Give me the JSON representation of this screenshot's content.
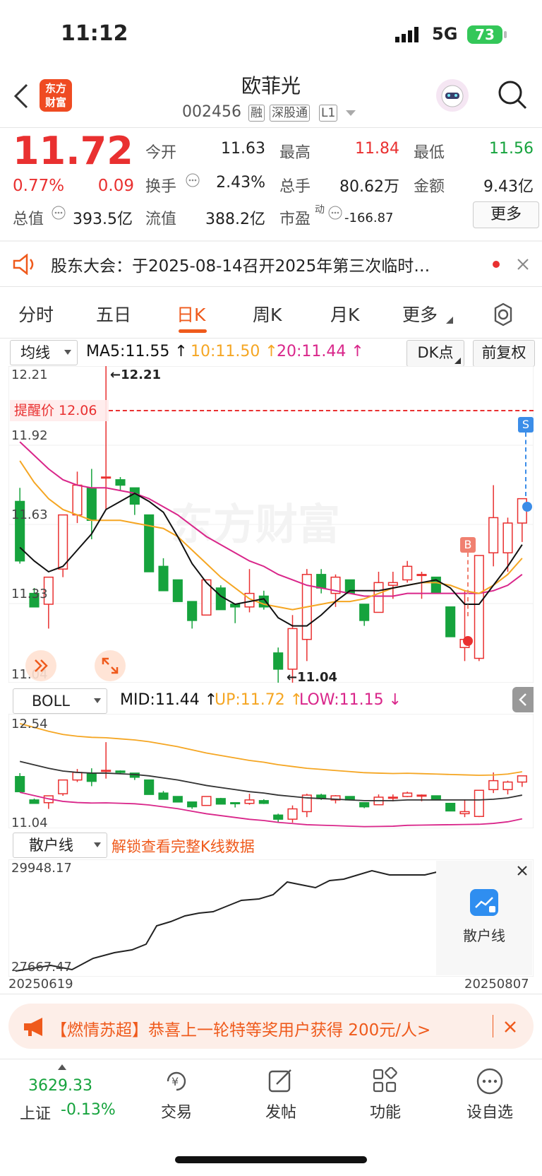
{
  "status": {
    "time": "11:12",
    "network": "5G",
    "battery": "73"
  },
  "nav": {
    "back_icon": "chevron-left-icon",
    "logo_line1": "东方",
    "logo_line2": "财富",
    "stock_name": "欧菲光",
    "stock_code": "002456",
    "tags": [
      "融",
      "深股通",
      "L1"
    ]
  },
  "quote": {
    "price": "11.72",
    "change_pct": "0.77%",
    "change": "0.09",
    "open_label": "今开",
    "open": "11.63",
    "high_label": "最高",
    "high": "11.84",
    "low_label": "最低",
    "low": "11.56",
    "turnover_label": "换手",
    "turnover": "2.43%",
    "volume_label": "总手",
    "volume": "80.62万",
    "amount_label": "金额",
    "amount": "9.43亿",
    "mktcap_label": "总值",
    "mktcap": "393.5亿",
    "float_label": "流值",
    "float_cap": "388.2亿",
    "pe_label": "市盈",
    "pe_sup": "动",
    "pe": "-166.87",
    "more": "更多"
  },
  "notice": {
    "text": "股东大会：于2025-08-14召开2025年第三次临时…"
  },
  "tabs": [
    "分时",
    "五日",
    "日K",
    "周K",
    "月K",
    "更多"
  ],
  "active_tab": 2,
  "kline": {
    "ma_select": "均线",
    "ma5": "MA5:11.55 ↑",
    "ma10": "10:11.50 ↑",
    "ma20": "20:11.44 ↑",
    "dk": "DK点",
    "adjust": "前复权",
    "ytop": "12.21",
    "y2": "11.92",
    "y3": "11.63",
    "y4": "11.33",
    "ybot": "11.04",
    "max_label": "←12.21",
    "min_label": "←11.04",
    "alert": "提醒价 12.06",
    "watermark": "东方财富",
    "sell_marker": "S",
    "buy_marker": "B"
  },
  "boll": {
    "select": "BOLL",
    "mid": "MID:11.44 ↑",
    "up": "UP:11.72 ↑",
    "low": "LOW:11.15 ↓",
    "ytop": "12.54",
    "ybot": "11.04"
  },
  "retail": {
    "select": "散户线",
    "unlock": "解锁查看完整K线数据",
    "ytop": "29948.17",
    "ybot": "27667.47",
    "date_start": "20250619",
    "date_end": "20250807",
    "badge": "散户线"
  },
  "banner": {
    "text": "【燃情苏超】恭喜上一轮特等奖用户获得 200元/人>"
  },
  "tabbar": {
    "index_value": "3629.33",
    "index_name": "上证",
    "index_change": "-0.13%",
    "items": [
      "交易",
      "发帖",
      "功能",
      "设自选"
    ]
  },
  "colors": {
    "up": "#e93030",
    "down": "#16a33d",
    "accent": "#ef5a1c",
    "ma5": "#111111",
    "ma10": "#f5a623",
    "ma20": "#d9268a"
  },
  "chart_data": {
    "type": "candlestick",
    "ylim": [
      11.04,
      12.21
    ],
    "ohlc": [
      [
        11.71,
        11.76,
        11.48,
        11.49
      ],
      [
        11.37,
        11.39,
        11.32,
        11.32
      ],
      [
        11.33,
        11.43,
        11.24,
        11.43
      ],
      [
        11.46,
        11.66,
        11.43,
        11.66
      ],
      [
        11.66,
        11.82,
        11.63,
        11.77
      ],
      [
        11.76,
        11.83,
        11.57,
        11.64
      ],
      [
        11.8,
        12.21,
        11.68,
        11.8
      ],
      [
        11.79,
        11.8,
        11.75,
        11.77
      ],
      [
        11.76,
        11.76,
        11.66,
        11.7
      ],
      [
        11.66,
        11.66,
        11.45,
        11.45
      ],
      [
        11.47,
        11.5,
        11.38,
        11.38
      ],
      [
        11.42,
        11.42,
        11.34,
        11.34
      ],
      [
        11.34,
        11.34,
        11.24,
        11.27
      ],
      [
        11.29,
        11.42,
        11.29,
        11.42
      ],
      [
        11.39,
        11.4,
        11.31,
        11.31
      ],
      [
        11.33,
        11.33,
        11.26,
        11.32
      ],
      [
        11.32,
        11.46,
        11.3,
        11.37
      ],
      [
        11.36,
        11.38,
        11.31,
        11.32
      ],
      [
        11.15,
        11.17,
        11.04,
        11.09
      ],
      [
        11.09,
        11.29,
        11.04,
        11.24
      ],
      [
        11.2,
        11.46,
        11.12,
        11.44
      ],
      [
        11.44,
        11.46,
        11.37,
        11.39
      ],
      [
        11.37,
        11.44,
        11.32,
        11.43
      ],
      [
        11.42,
        11.42,
        11.37,
        11.37
      ],
      [
        11.33,
        11.33,
        11.25,
        11.27
      ],
      [
        11.3,
        11.45,
        11.3,
        11.41
      ],
      [
        11.4,
        11.45,
        11.35,
        11.41
      ],
      [
        11.42,
        11.49,
        11.41,
        11.47
      ],
      [
        11.44,
        11.45,
        11.35,
        11.44
      ],
      [
        11.43,
        11.43,
        11.37,
        11.37
      ],
      [
        11.32,
        11.32,
        11.21,
        11.21
      ],
      [
        11.17,
        11.38,
        11.12,
        11.2
      ],
      [
        11.13,
        11.49,
        11.12,
        11.51
      ],
      [
        11.52,
        11.77,
        11.47,
        11.65
      ],
      [
        11.52,
        11.65,
        11.45,
        11.63
      ],
      [
        11.63,
        11.72,
        11.56,
        11.72
      ]
    ],
    "ma5": [
      11.54,
      11.49,
      11.45,
      11.47,
      11.53,
      11.59,
      11.68,
      11.71,
      11.74,
      11.71,
      11.67,
      11.58,
      11.48,
      11.41,
      11.36,
      11.33,
      11.34,
      11.35,
      11.28,
      11.25,
      11.25,
      11.29,
      11.34,
      11.38,
      11.38,
      11.38,
      11.39,
      11.4,
      11.41,
      11.42,
      11.39,
      11.33,
      11.33,
      11.4,
      11.47,
      11.55
    ],
    "ma10": [
      11.86,
      11.78,
      11.72,
      11.68,
      11.66,
      11.64,
      11.64,
      11.64,
      11.63,
      11.62,
      11.61,
      11.58,
      11.53,
      11.48,
      11.43,
      11.39,
      11.35,
      11.33,
      11.32,
      11.31,
      11.32,
      11.33,
      11.34,
      11.34,
      11.35,
      11.37,
      11.39,
      11.4,
      11.41,
      11.41,
      11.4,
      11.38,
      11.37,
      11.4,
      11.44,
      11.5
    ],
    "ma20": [
      11.93,
      11.88,
      11.83,
      11.79,
      11.77,
      11.76,
      11.76,
      11.75,
      11.74,
      11.72,
      11.69,
      11.66,
      11.62,
      11.58,
      11.55,
      11.52,
      11.49,
      11.47,
      11.44,
      11.42,
      11.4,
      11.39,
      11.38,
      11.37,
      11.36,
      11.36,
      11.36,
      11.37,
      11.37,
      11.37,
      11.37,
      11.37,
      11.37,
      11.38,
      11.4,
      11.44
    ]
  }
}
